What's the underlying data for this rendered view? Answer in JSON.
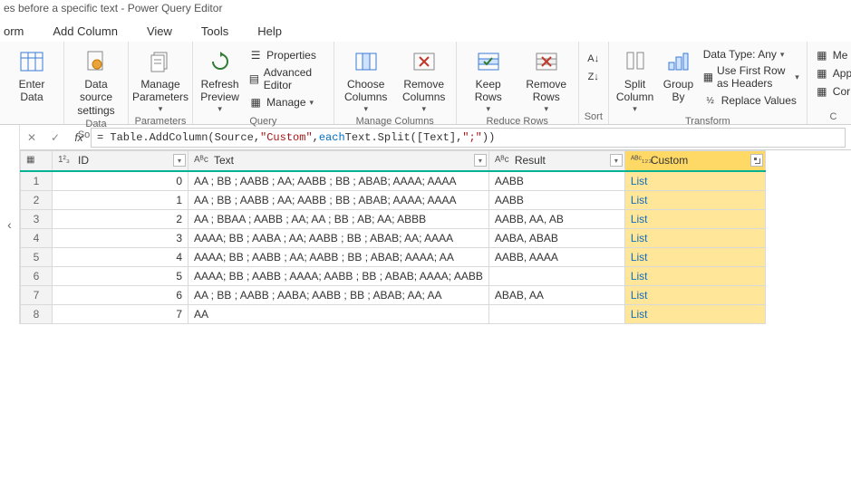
{
  "window": {
    "title": "es before a specific text - Power Query Editor"
  },
  "menu": {
    "items": [
      "orm",
      "Add Column",
      "View",
      "Tools",
      "Help"
    ]
  },
  "ribbon": {
    "enter_data": "Enter\nData",
    "data_source": "Data source\nsettings",
    "data_sources_label": "Data Sources",
    "manage_params": "Manage\nParameters",
    "parameters_label": "Parameters",
    "refresh": "Refresh\nPreview",
    "properties": "Properties",
    "advanced_editor": "Advanced Editor",
    "manage": "Manage",
    "query_label": "Query",
    "choose_cols": "Choose\nColumns",
    "remove_cols": "Remove\nColumns",
    "manage_cols_label": "Manage Columns",
    "keep_rows": "Keep\nRows",
    "remove_rows": "Remove\nRows",
    "reduce_rows_label": "Reduce Rows",
    "sort_label": "Sort",
    "split_col": "Split\nColumn",
    "group_by": "Group\nBy",
    "data_type": "Data Type: Any",
    "first_row_headers": "Use First Row as Headers",
    "replace_values": "Replace Values",
    "transform_label": "Transform",
    "merge": "Me",
    "append": "App",
    "combine": "Cor"
  },
  "formula": {
    "prefix": "= Table.AddColumn(Source, ",
    "arg_custom": "\"Custom\"",
    "mid": ", ",
    "each": "each",
    "rest": " Text.Split([Text], ",
    "semi": "\";\"",
    "end": " ))"
  },
  "columns": {
    "id": "ID",
    "text": "Text",
    "result": "Result",
    "custom": "Custom"
  },
  "rows": [
    {
      "n": "1",
      "id": "0",
      "text": "AA ; BB ; AABB ; AA; AABB ; BB ; ABAB; AAAA; AAAA",
      "result": "AABB",
      "custom": "List"
    },
    {
      "n": "2",
      "id": "1",
      "text": "AA ; BB ; AABB ; AA; AABB ; BB ; ABAB; AAAA; AAAA",
      "result": "AABB",
      "custom": "List"
    },
    {
      "n": "3",
      "id": "2",
      "text": "AA ; BBAA ; AABB ; AA; AA ; BB ; AB; AA; ABBB",
      "result": "AABB, AA, AB",
      "custom": "List"
    },
    {
      "n": "4",
      "id": "3",
      "text": "AAAA; BB ; AABA ; AA; AABB ; BB ; ABAB; AA; AAAA",
      "result": "AABA, ABAB",
      "custom": "List"
    },
    {
      "n": "5",
      "id": "4",
      "text": "AAAA; BB ; AABB ; AA; AABB ; BB ; ABAB; AAAA; AA",
      "result": "AABB, AAAA",
      "custom": "List"
    },
    {
      "n": "6",
      "id": "5",
      "text": "AAAA; BB ; AABB ; AAAA; AABB ; BB ; ABAB; AAAA; AABB",
      "result": "",
      "custom": "List"
    },
    {
      "n": "7",
      "id": "6",
      "text": "AA ; BB ; AABB ; AABA; AABB ; BB ; ABAB; AA; AA",
      "result": "ABAB, AA",
      "custom": "List"
    },
    {
      "n": "8",
      "id": "7",
      "text": "AA",
      "result": "",
      "custom": "List"
    }
  ]
}
